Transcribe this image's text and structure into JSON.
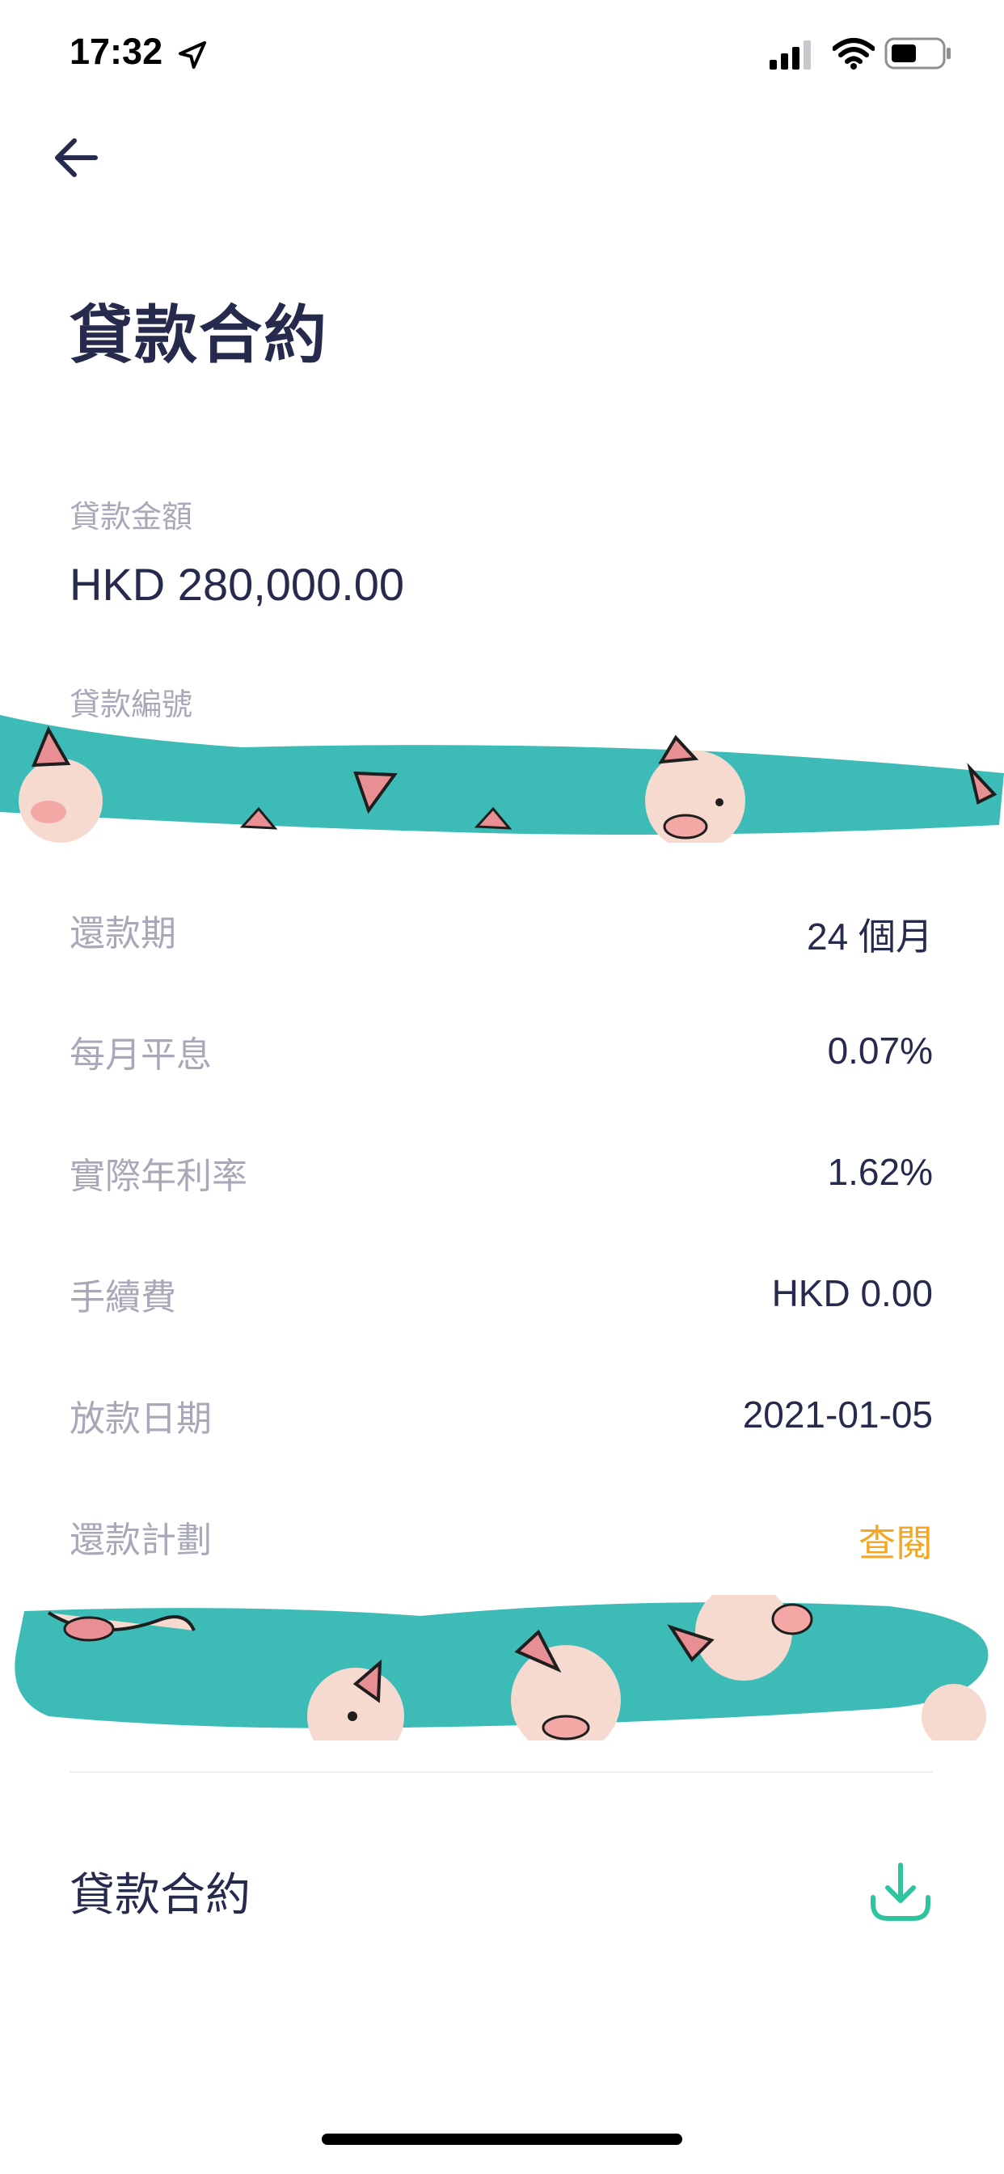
{
  "status_bar": {
    "time": "17:32",
    "icons": [
      "location-arrow-icon",
      "cellular-signal-icon",
      "wifi-icon",
      "battery-icon"
    ]
  },
  "nav": {
    "back_icon": "arrow-left-icon"
  },
  "page": {
    "title": "貸款合約"
  },
  "loan": {
    "amount_label": "貸款金額",
    "amount_value": "HKD 280,000.00",
    "number_label": "貸款編號"
  },
  "details": [
    {
      "label": "還款期",
      "value": "24 個月"
    },
    {
      "label": "每月平息",
      "value": "0.07%"
    },
    {
      "label": "實際年利率",
      "value": "1.62%"
    },
    {
      "label": "手續費",
      "value": "HKD 0.00"
    },
    {
      "label": "放款日期",
      "value": "2021-01-05"
    },
    {
      "label": "還款計劃",
      "value": "查閱"
    }
  ],
  "document": {
    "label": "貸款合約",
    "icon": "download-icon"
  },
  "colors": {
    "primary_text": "#262b4d",
    "secondary_text": "#a7a9b8",
    "link": "#f5a623",
    "accent": "#2ec4a0",
    "redaction_teal": "#3dbcb7"
  }
}
